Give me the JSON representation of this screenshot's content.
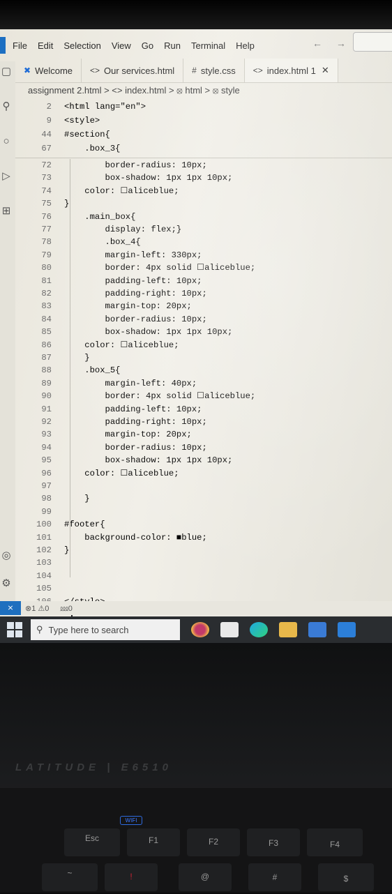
{
  "menu": [
    "File",
    "Edit",
    "Selection",
    "View",
    "Go",
    "Run",
    "Terminal",
    "Help"
  ],
  "nav_arrows": "← →",
  "tabs": [
    {
      "label": "Welcome",
      "icon": "vscode-icon"
    },
    {
      "label": "Our services.html",
      "icon": "code-icon"
    },
    {
      "label": "style.css",
      "icon": "hash-icon"
    },
    {
      "label": "index.html 1",
      "icon": "code-icon",
      "close": "✕"
    }
  ],
  "breadcrumb": "assignment 2.html > <> index.html > ⦻ html > ⦻ style",
  "sticky_lines": [
    {
      "n": "2",
      "t": "<html lang=\"en\">"
    },
    {
      "n": "9",
      "t": "<style>"
    },
    {
      "n": "44",
      "t": "#section{"
    },
    {
      "n": "67",
      "t": "    .box_3{"
    }
  ],
  "code_lines": [
    {
      "n": "72",
      "t": "        border-radius: 10px;"
    },
    {
      "n": "73",
      "t": "        box-shadow: 1px 1px 10px;"
    },
    {
      "n": "74",
      "t": "    color: ☐aliceblue;"
    },
    {
      "n": "75",
      "t": "}"
    },
    {
      "n": "76",
      "t": "    .main_box{"
    },
    {
      "n": "77",
      "t": "        display: flex;}"
    },
    {
      "n": "78",
      "t": "        .box_4{"
    },
    {
      "n": "79",
      "t": "        margin-left: 330px;"
    },
    {
      "n": "80",
      "t": "        border: 4px solid ☐aliceblue;"
    },
    {
      "n": "81",
      "t": "        padding-left: 10px;"
    },
    {
      "n": "82",
      "t": "        padding-right: 10px;"
    },
    {
      "n": "83",
      "t": "        margin-top: 20px;"
    },
    {
      "n": "84",
      "t": "        border-radius: 10px;"
    },
    {
      "n": "85",
      "t": "        box-shadow: 1px 1px 10px;"
    },
    {
      "n": "86",
      "t": "    color: ☐aliceblue;"
    },
    {
      "n": "87",
      "t": "    }"
    },
    {
      "n": "88",
      "t": "    .box_5{"
    },
    {
      "n": "89",
      "t": "        margin-left: 40px;"
    },
    {
      "n": "90",
      "t": "        border: 4px solid ☐aliceblue;"
    },
    {
      "n": "91",
      "t": "        padding-left: 10px;"
    },
    {
      "n": "92",
      "t": "        padding-right: 10px;"
    },
    {
      "n": "93",
      "t": "        margin-top: 20px;"
    },
    {
      "n": "94",
      "t": "        border-radius: 10px;"
    },
    {
      "n": "95",
      "t": "        box-shadow: 1px 1px 10px;"
    },
    {
      "n": "96",
      "t": "    color: ☐aliceblue;"
    },
    {
      "n": "97",
      "t": ""
    },
    {
      "n": "98",
      "t": "    }"
    },
    {
      "n": "99",
      "t": ""
    },
    {
      "n": "100",
      "t": "#footer{"
    },
    {
      "n": "101",
      "t": "    background-color: ■blue;"
    },
    {
      "n": "102",
      "t": "}"
    },
    {
      "n": "103",
      "t": ""
    },
    {
      "n": "104",
      "t": ""
    },
    {
      "n": "105",
      "t": ""
    },
    {
      "n": "106",
      "t": "</style>"
    }
  ],
  "status": {
    "problems": "⊗1 ⚠0",
    "ports": "⅏0"
  },
  "taskbar": {
    "search_placeholder": "Type here to search"
  },
  "laptop": {
    "brand": "LATITUDE | E6510",
    "wifi_badge": "WIFI"
  },
  "keys": [
    "Esc",
    "F1",
    "F2",
    "F3",
    "F4",
    "~",
    "!",
    "@",
    "#",
    "$"
  ],
  "colors": {
    "accent": "#1e6fbf",
    "editor_bg": "#eceae2",
    "taskbar": "#2a2d30"
  }
}
